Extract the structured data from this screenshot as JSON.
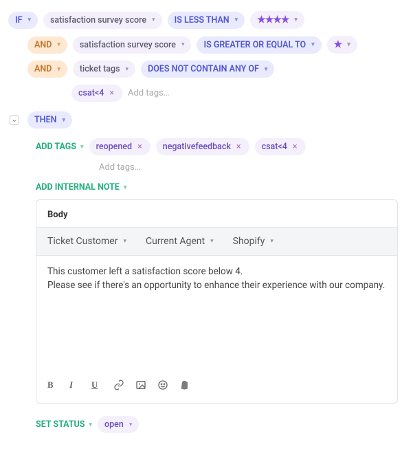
{
  "if": {
    "label": "IF"
  },
  "and": {
    "label": "AND"
  },
  "then": {
    "label": "THEN"
  },
  "conditions": {
    "c0": {
      "field": "satisfaction survey score",
      "op": "IS LESS THAN",
      "value_stars": "★★★★"
    },
    "c1": {
      "field": "satisfaction survey score",
      "op": "IS GREATER OR EQUAL TO",
      "value_stars": "★"
    },
    "c2": {
      "field": "ticket tags",
      "op": "DOES NOT CONTAIN ANY OF",
      "tags": {
        "t0": "csat<4"
      },
      "placeholder": "Add tags…"
    }
  },
  "actions": {
    "add_tags": {
      "label": "ADD TAGS",
      "tags": {
        "t0": "reopened",
        "t1": "negativefeedback",
        "t2": "csat<4"
      },
      "placeholder": "Add tags…"
    },
    "add_note": {
      "label": "ADD INTERNAL NOTE"
    },
    "body": {
      "title": "Body",
      "vars": {
        "v0": "Ticket Customer",
        "v1": "Current Agent",
        "v2": "Shopify"
      },
      "text_l1": "This customer left a satisfaction score below 4.",
      "text_l2": "Please see if there's an opportunity to enhance their experience with our company."
    },
    "set_status": {
      "label": "SET STATUS",
      "value": "open"
    }
  }
}
